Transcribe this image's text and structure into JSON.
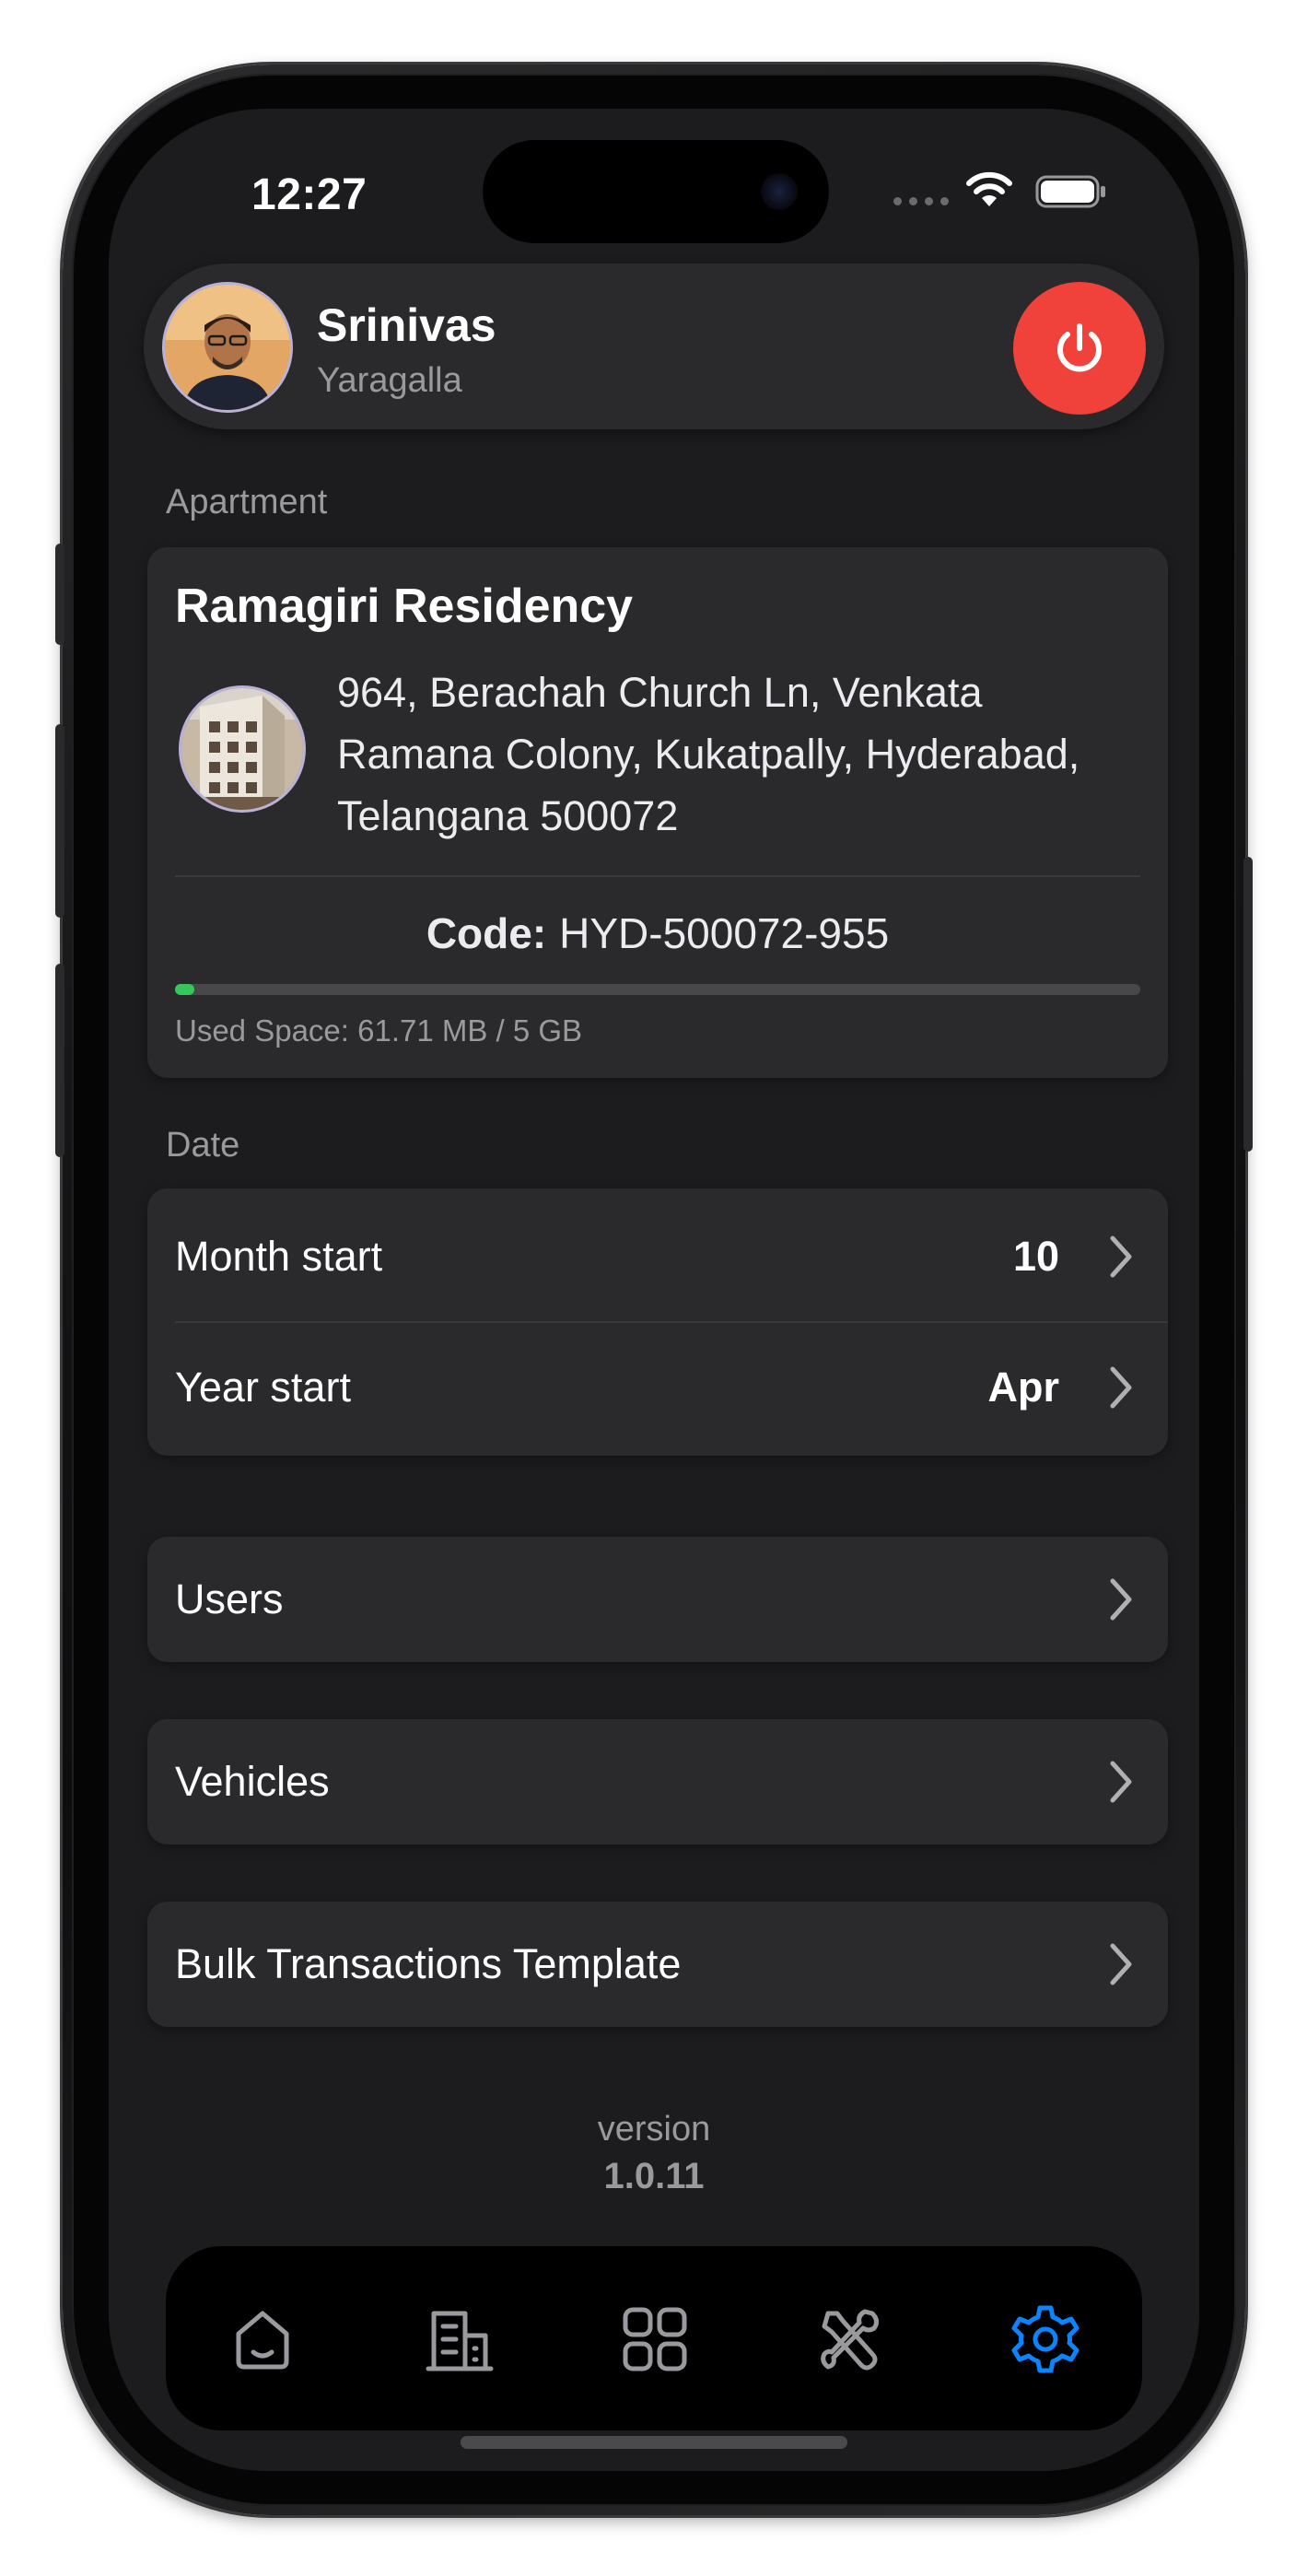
{
  "status_bar": {
    "time": "12:27"
  },
  "profile": {
    "first_name": "Srinivas",
    "last_name": "Yaragalla"
  },
  "apartment_section": {
    "label": "Apartment",
    "name": "Ramagiri Residency",
    "address": "964, Berachah Church Ln, Venkata Ramana Colony, Kukatpally, Hyderabad, Telangana 500072",
    "code_label": "Code:",
    "code": "HYD-500072-955",
    "used_space_text": "Used Space: 61.71 MB / 5 GB",
    "used_fraction": 0.012
  },
  "date_section": {
    "label": "Date",
    "month_start_label": "Month start",
    "month_start_value": "10",
    "year_start_label": "Year start",
    "year_start_value": "Apr"
  },
  "menu": {
    "users": "Users",
    "vehicles": "Vehicles",
    "bulk_template": "Bulk Transactions Template"
  },
  "version": {
    "label": "version",
    "number": "1.0.11"
  },
  "tab_bar": {
    "tabs": [
      {
        "icon": "home-icon",
        "active": false
      },
      {
        "icon": "building-icon",
        "active": false
      },
      {
        "icon": "grid-icon",
        "active": false
      },
      {
        "icon": "tools-icon",
        "active": false
      },
      {
        "icon": "settings-icon",
        "active": true
      }
    ],
    "active_color": "#0a84ff",
    "inactive_color": "#9a9a9e"
  },
  "colors": {
    "background": "#1c1c1e",
    "card": "#2a2a2c",
    "logout": "#f0413b",
    "usage_fill": "#34c759"
  }
}
